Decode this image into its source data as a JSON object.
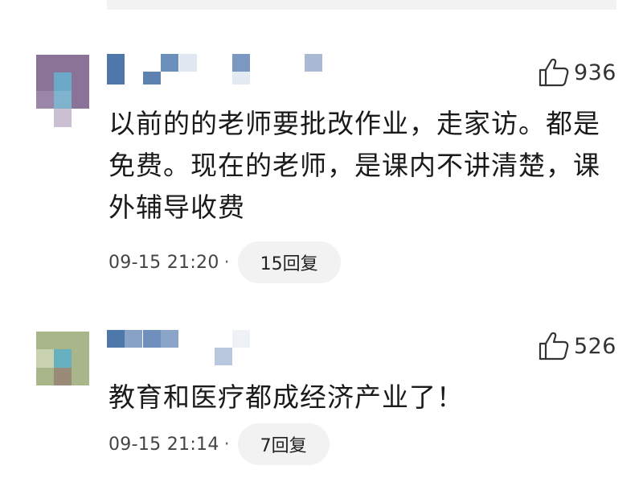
{
  "comments": [
    {
      "likes": "936",
      "text": "以前的的老师要批改作业，走家访。都是免费。现在的老师，是课内不讲清楚，课外辅导收费",
      "timestamp": "09-15 21:20",
      "separator": "·",
      "replies": "15回复"
    },
    {
      "likes": "526",
      "text": "教育和医疗都成经济产业了！",
      "timestamp": "09-15 21:14",
      "separator": "·",
      "replies": "7回复"
    }
  ],
  "icons": {
    "like": "thumbs-up-icon"
  },
  "colors": {
    "pill_background": "#f2f2f2",
    "text": "#1a1a1a",
    "meta_text": "#444444"
  }
}
